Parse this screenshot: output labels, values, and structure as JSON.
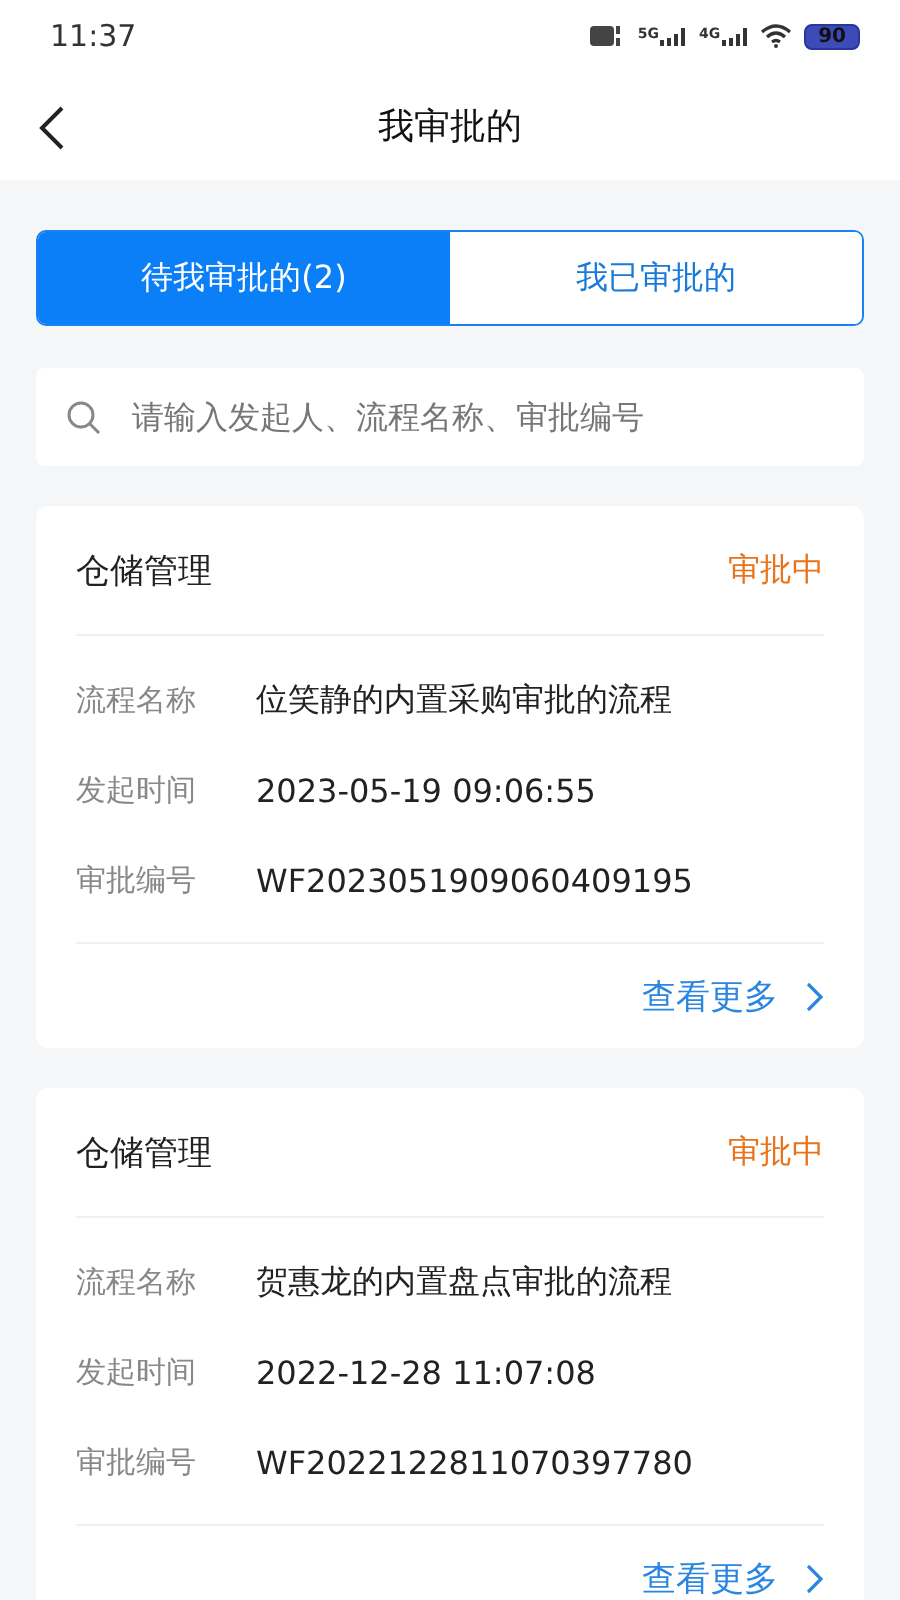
{
  "status_bar": {
    "time": "11:37",
    "networks": [
      "5G",
      "4G"
    ],
    "battery": "90"
  },
  "header": {
    "title": "我审批的"
  },
  "tabs": [
    {
      "label": "待我审批的(2)",
      "selected": true
    },
    {
      "label": "我已审批的",
      "selected": false
    }
  ],
  "search": {
    "placeholder": "请输入发起人、流程名称、审批编号"
  },
  "cards": [
    {
      "title": "仓储管理",
      "status": "审批中",
      "fields": [
        {
          "label": "流程名称",
          "value": "位笑静的内置采购审批的流程"
        },
        {
          "label": "发起时间",
          "value": "2023-05-19 09:06:55"
        },
        {
          "label": "审批编号",
          "value": "WF2023051909060409195"
        }
      ],
      "more": "查看更多"
    },
    {
      "title": "仓储管理",
      "status": "审批中",
      "fields": [
        {
          "label": "流程名称",
          "value": "贺惠龙的内置盘点审批的流程"
        },
        {
          "label": "发起时间",
          "value": "2022-12-28 11:07:08"
        },
        {
          "label": "审批编号",
          "value": "WF2022122811070397780"
        }
      ],
      "more": "查看更多"
    }
  ]
}
